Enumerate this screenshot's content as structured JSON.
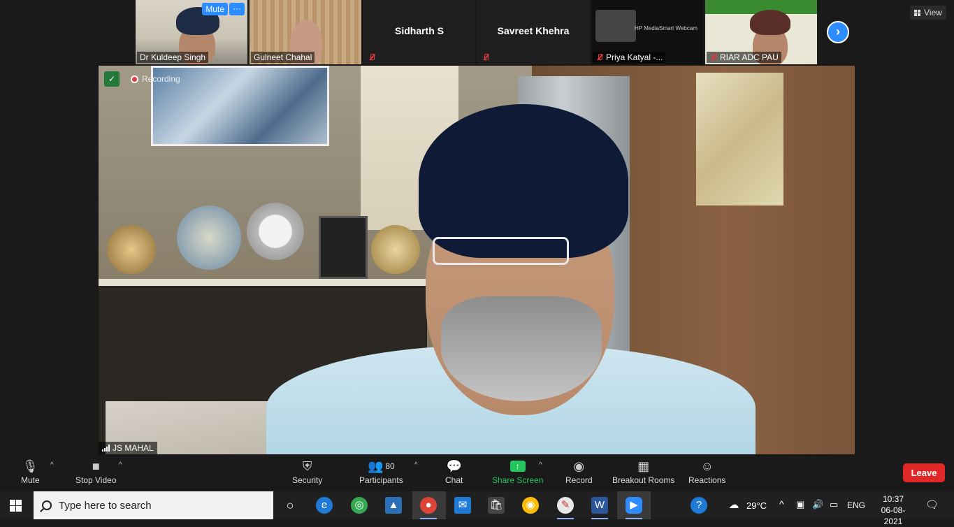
{
  "participants": [
    {
      "name": "Dr Kuldeep Singh",
      "muted": false
    },
    {
      "name": "Gulneet Chahal",
      "muted": false
    },
    {
      "name": "Sidharth S",
      "muted": true
    },
    {
      "name": "Savreet Khehra",
      "muted": true
    },
    {
      "name": "Priya Katyal -...",
      "muted": true
    },
    {
      "name": "RIAR ADC PAU",
      "muted": true
    }
  ],
  "hover_controls": {
    "mute_label": "Mute",
    "more_label": "···"
  },
  "priya_tile": {
    "device_caption": "HP MediaSmart Webcam"
  },
  "view_label": "View",
  "main_video": {
    "speaker_name": "JS MAHAL",
    "recording_label": "Recording"
  },
  "controls": {
    "mute": "Mute",
    "stop_video": "Stop Video",
    "security": "Security",
    "participants": "Participants",
    "participants_count": "80",
    "chat": "Chat",
    "share_screen": "Share Screen",
    "record": "Record",
    "breakout_rooms": "Breakout Rooms",
    "reactions": "Reactions",
    "leave": "Leave"
  },
  "taskbar": {
    "search_placeholder": "Type here to search",
    "temperature": "29°C",
    "language": "ENG",
    "time": "10:37",
    "date": "06-08-2021"
  },
  "colors": {
    "accent_blue": "#2d8cff",
    "leave_red": "#e02828",
    "share_green": "#22c55e",
    "muted_red": "#e0393e"
  }
}
